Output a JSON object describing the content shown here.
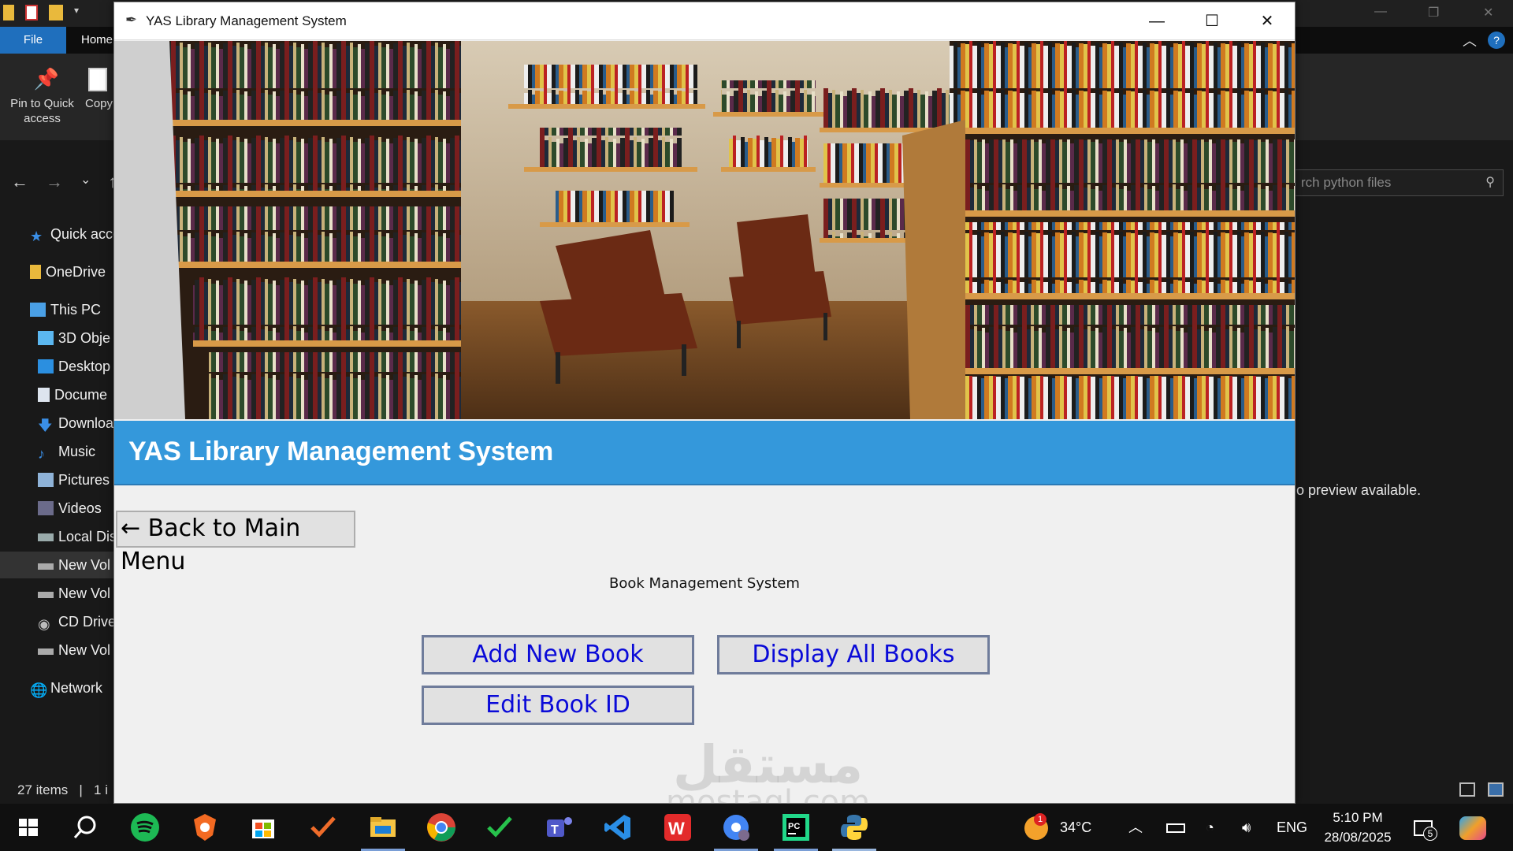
{
  "explorer": {
    "file_tab": "File",
    "home_tab": "Home",
    "pin_label": "Pin to Quick access",
    "copy_label": "Copy",
    "search_placeholder": "rch python files",
    "preview_text": "o preview available.",
    "status_items": "27 items",
    "status_sep": "|",
    "status_selected": "1 i",
    "sidebar": [
      {
        "label": "Quick acce",
        "icon": "star-icon"
      },
      {
        "label": "OneDrive",
        "icon": "folder-icon"
      },
      {
        "label": "This PC",
        "icon": "computer-icon"
      },
      {
        "label": "3D Obje",
        "icon": "cube-icon"
      },
      {
        "label": "Desktop",
        "icon": "desktop-icon"
      },
      {
        "label": "Docume",
        "icon": "document-icon"
      },
      {
        "label": "Downloa",
        "icon": "download-icon"
      },
      {
        "label": "Music",
        "icon": "music-icon"
      },
      {
        "label": "Pictures",
        "icon": "pictures-icon"
      },
      {
        "label": "Videos",
        "icon": "videos-icon"
      },
      {
        "label": "Local Dis",
        "icon": "drive-icon"
      },
      {
        "label": "New Vol",
        "icon": "drive-icon"
      },
      {
        "label": "New Vol",
        "icon": "drive-icon"
      },
      {
        "label": "CD Drive",
        "icon": "cd-icon"
      },
      {
        "label": "New Vol",
        "icon": "drive-icon"
      },
      {
        "label": "Network",
        "icon": "network-icon"
      }
    ]
  },
  "app": {
    "window_title": "YAS Library Management System",
    "header_title": "YAS Library Management System",
    "back_button": "← Back to Main Menu",
    "section_label": "Book Management System",
    "buttons": {
      "add": "Add New Book",
      "display": "Display All Books",
      "edit": "Edit Book ID"
    },
    "watermark_big": "مستقل",
    "watermark_small": "mostaql.com"
  },
  "taskbar": {
    "weather": "34°C",
    "weather_badge": "1",
    "language": "ENG",
    "time": "5:10 PM",
    "date": "28/08/2025",
    "notifications": "5",
    "apps": [
      "start",
      "search",
      "spotify",
      "brave",
      "microsoft-store",
      "tasks",
      "file-explorer",
      "chrome",
      "check",
      "teams",
      "vscode",
      "wps",
      "chrome-profile",
      "pycharm",
      "python"
    ]
  },
  "colors": {
    "header_band": "#3498db",
    "button_text": "#0a0ad8",
    "window_bg": "#f0f0f0"
  }
}
